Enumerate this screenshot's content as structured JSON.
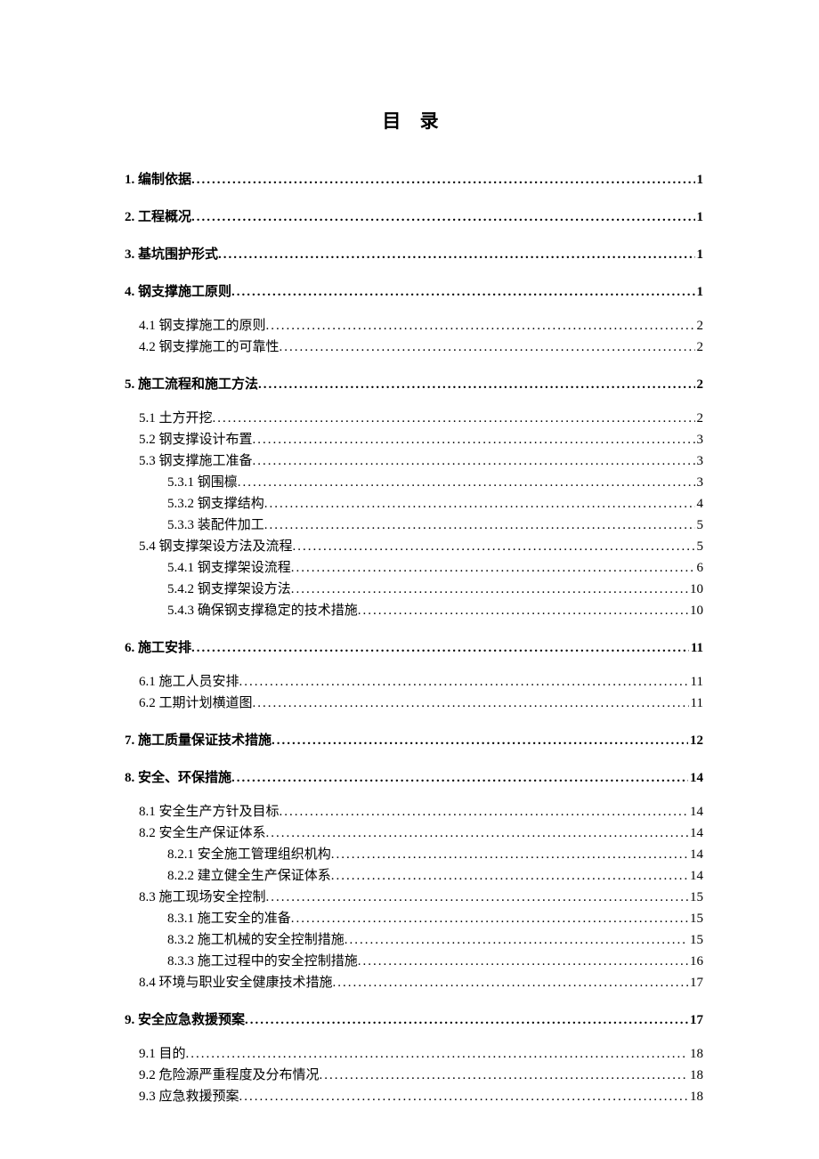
{
  "title": "目 录",
  "entries": [
    {
      "level": 1,
      "label": "1. 编制依据",
      "page": "1"
    },
    {
      "level": 1,
      "label": "2. 工程概况",
      "page": "1"
    },
    {
      "level": 1,
      "label": "3. 基坑围护形式",
      "page": "1"
    },
    {
      "level": 1,
      "label": "4. 钢支撑施工原则",
      "page": "1"
    },
    {
      "level": 2,
      "label": "4.1 钢支撑施工的原则",
      "page": "2",
      "groupStart": true
    },
    {
      "level": 2,
      "label": "4.2 钢支撑施工的可靠性 ",
      "page": "2"
    },
    {
      "level": 1,
      "label": "5. 施工流程和施工方法",
      "page": "2"
    },
    {
      "level": 2,
      "label": "5.1 土方开挖",
      "page": "2",
      "groupStart": true
    },
    {
      "level": 2,
      "label": "5.2 钢支撑设计布置",
      "page": "3"
    },
    {
      "level": 2,
      "label": "5.3 钢支撑施工准备",
      "page": "3"
    },
    {
      "level": 3,
      "label": "5.3.1 钢围檩",
      "page": "3"
    },
    {
      "level": 3,
      "label": "5.3.2 钢支撑结构",
      "page": "4"
    },
    {
      "level": 3,
      "label": "5.3.3 装配件加工",
      "page": "5"
    },
    {
      "level": 2,
      "label": "5.4 钢支撑架设方法及流程",
      "page": "5"
    },
    {
      "level": 3,
      "label": "5.4.1 钢支撑架设流程",
      "page": " 6"
    },
    {
      "level": 3,
      "label": "5.4.2 钢支撑架设方法",
      "page": "10"
    },
    {
      "level": 3,
      "label": "5.4.3 确保钢支撑稳定的技术措施",
      "page": "10"
    },
    {
      "level": 1,
      "label": "6. 施工安排",
      "page": "11"
    },
    {
      "level": 2,
      "label": "6.1 施工人员安排",
      "page": "11",
      "groupStart": true
    },
    {
      "level": 2,
      "label": "6.2 工期计划横道图",
      "page": "11"
    },
    {
      "level": 1,
      "label": "7. 施工质量保证技术措施",
      "page": "12"
    },
    {
      "level": 1,
      "label": "8. 安全、环保措施",
      "page": "14"
    },
    {
      "level": 2,
      "label": "8.1 安全生产方针及目标",
      "page": "14",
      "groupStart": true
    },
    {
      "level": 2,
      "label": "8.2 安全生产保证体系",
      "page": "14"
    },
    {
      "level": 3,
      "label": "8.2.1 安全施工管理组织机构",
      "page": " 14"
    },
    {
      "level": 3,
      "label": "8.2.2 建立健全生产保证体系",
      "page": "14"
    },
    {
      "level": 2,
      "label": "8.3 施工现场安全控制",
      "page": "15"
    },
    {
      "level": 3,
      "label": "8.3.1 施工安全的准备",
      "page": "15"
    },
    {
      "level": 3,
      "label": "8.3.2 施工机械的安全控制措施",
      "page": "15"
    },
    {
      "level": 3,
      "label": "8.3.3 施工过程中的安全控制措施",
      "page": "16"
    },
    {
      "level": 2,
      "label": "8.4 环境与职业安全健康技术措施",
      "page": "17"
    },
    {
      "level": 1,
      "label": "9. 安全应急救援预案",
      "page": "17"
    },
    {
      "level": 2,
      "label": "9.1 目的",
      "page": "18",
      "groupStart": true
    },
    {
      "level": 2,
      "label": "9.2 危险源严重程度及分布情况",
      "page": "18"
    },
    {
      "level": 2,
      "label": "9.3 应急救援预案",
      "page": "18"
    }
  ]
}
